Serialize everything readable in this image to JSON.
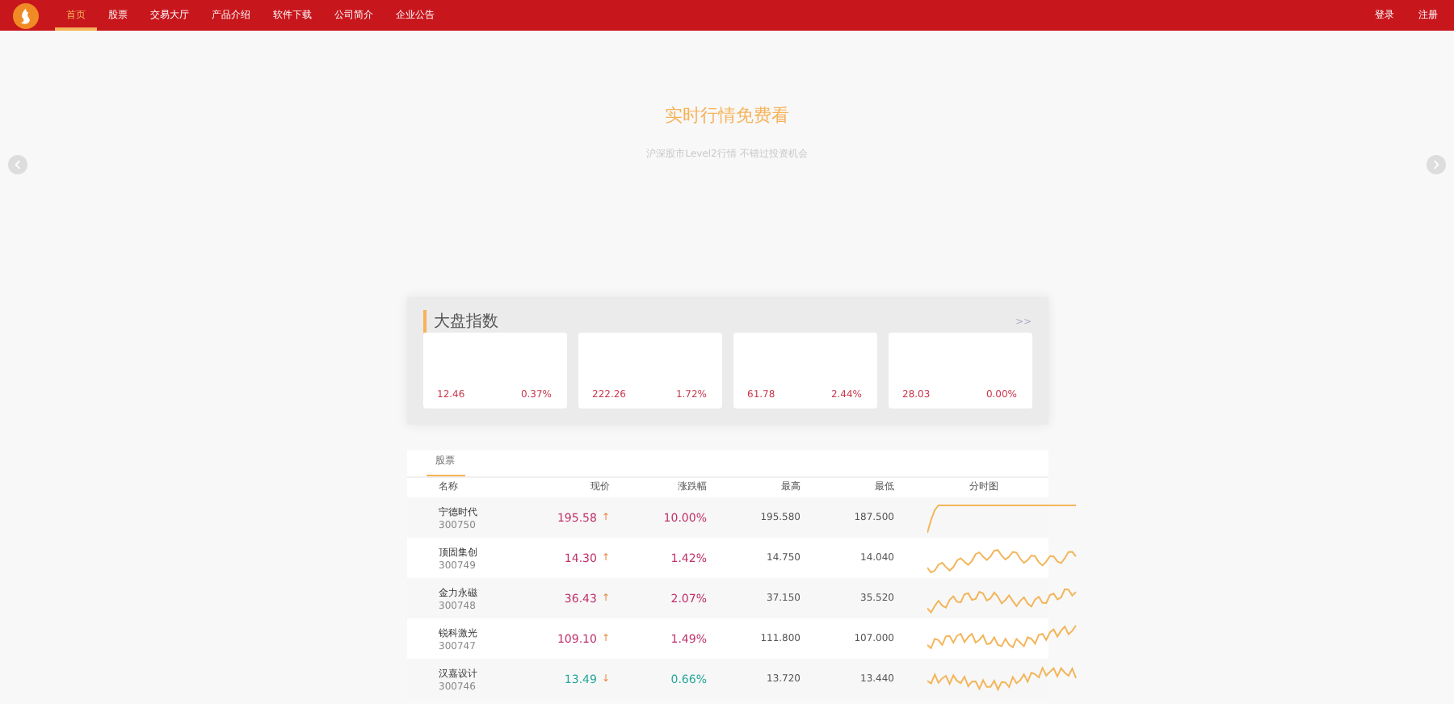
{
  "nav": {
    "items": [
      {
        "label": "首页",
        "selected": true
      },
      {
        "label": "股票",
        "selected": false
      },
      {
        "label": "交易大厅",
        "selected": false
      },
      {
        "label": "产品介绍",
        "selected": false
      },
      {
        "label": "软件下载",
        "selected": false
      },
      {
        "label": "公司简介",
        "selected": false
      },
      {
        "label": "企业公告",
        "selected": false
      }
    ],
    "login": "登录",
    "register": "注册"
  },
  "hero": {
    "title": "实时行情免费看",
    "subtitle": "沪深股市Level2行情 不错过投资机会"
  },
  "indices": {
    "title": "大盘指数",
    "more": ">>",
    "cards": [
      {
        "value": "12.46",
        "change": "0.37%"
      },
      {
        "value": "222.26",
        "change": "1.72%"
      },
      {
        "value": "61.78",
        "change": "2.44%"
      },
      {
        "value": "28.03",
        "change": "0.00%"
      }
    ]
  },
  "table": {
    "tabs": [
      {
        "label": "股票",
        "selected": true
      }
    ],
    "columns": [
      "名称",
      "现价",
      "涨跌幅",
      "最高",
      "最低",
      "分时图"
    ],
    "rows": [
      {
        "name": "宁德时代",
        "code": "300750",
        "price": "195.58",
        "arrow": "↑",
        "rising": true,
        "change": "10.00%",
        "high": "195.580",
        "low": "187.500"
      },
      {
        "name": "顶固集创",
        "code": "300749",
        "price": "14.30",
        "arrow": "↑",
        "rising": true,
        "change": "1.42%",
        "high": "14.750",
        "low": "14.040"
      },
      {
        "name": "金力永磁",
        "code": "300748",
        "price": "36.43",
        "arrow": "↑",
        "rising": true,
        "change": "2.07%",
        "high": "37.150",
        "low": "35.520"
      },
      {
        "name": "锐科激光",
        "code": "300747",
        "price": "109.10",
        "arrow": "↑",
        "rising": true,
        "change": "1.49%",
        "high": "111.800",
        "low": "107.000"
      },
      {
        "name": "汉嘉设计",
        "code": "300746",
        "price": "13.49",
        "arrow": "↓",
        "rising": false,
        "change": "0.66%",
        "high": "13.720",
        "low": "13.440"
      }
    ]
  }
}
